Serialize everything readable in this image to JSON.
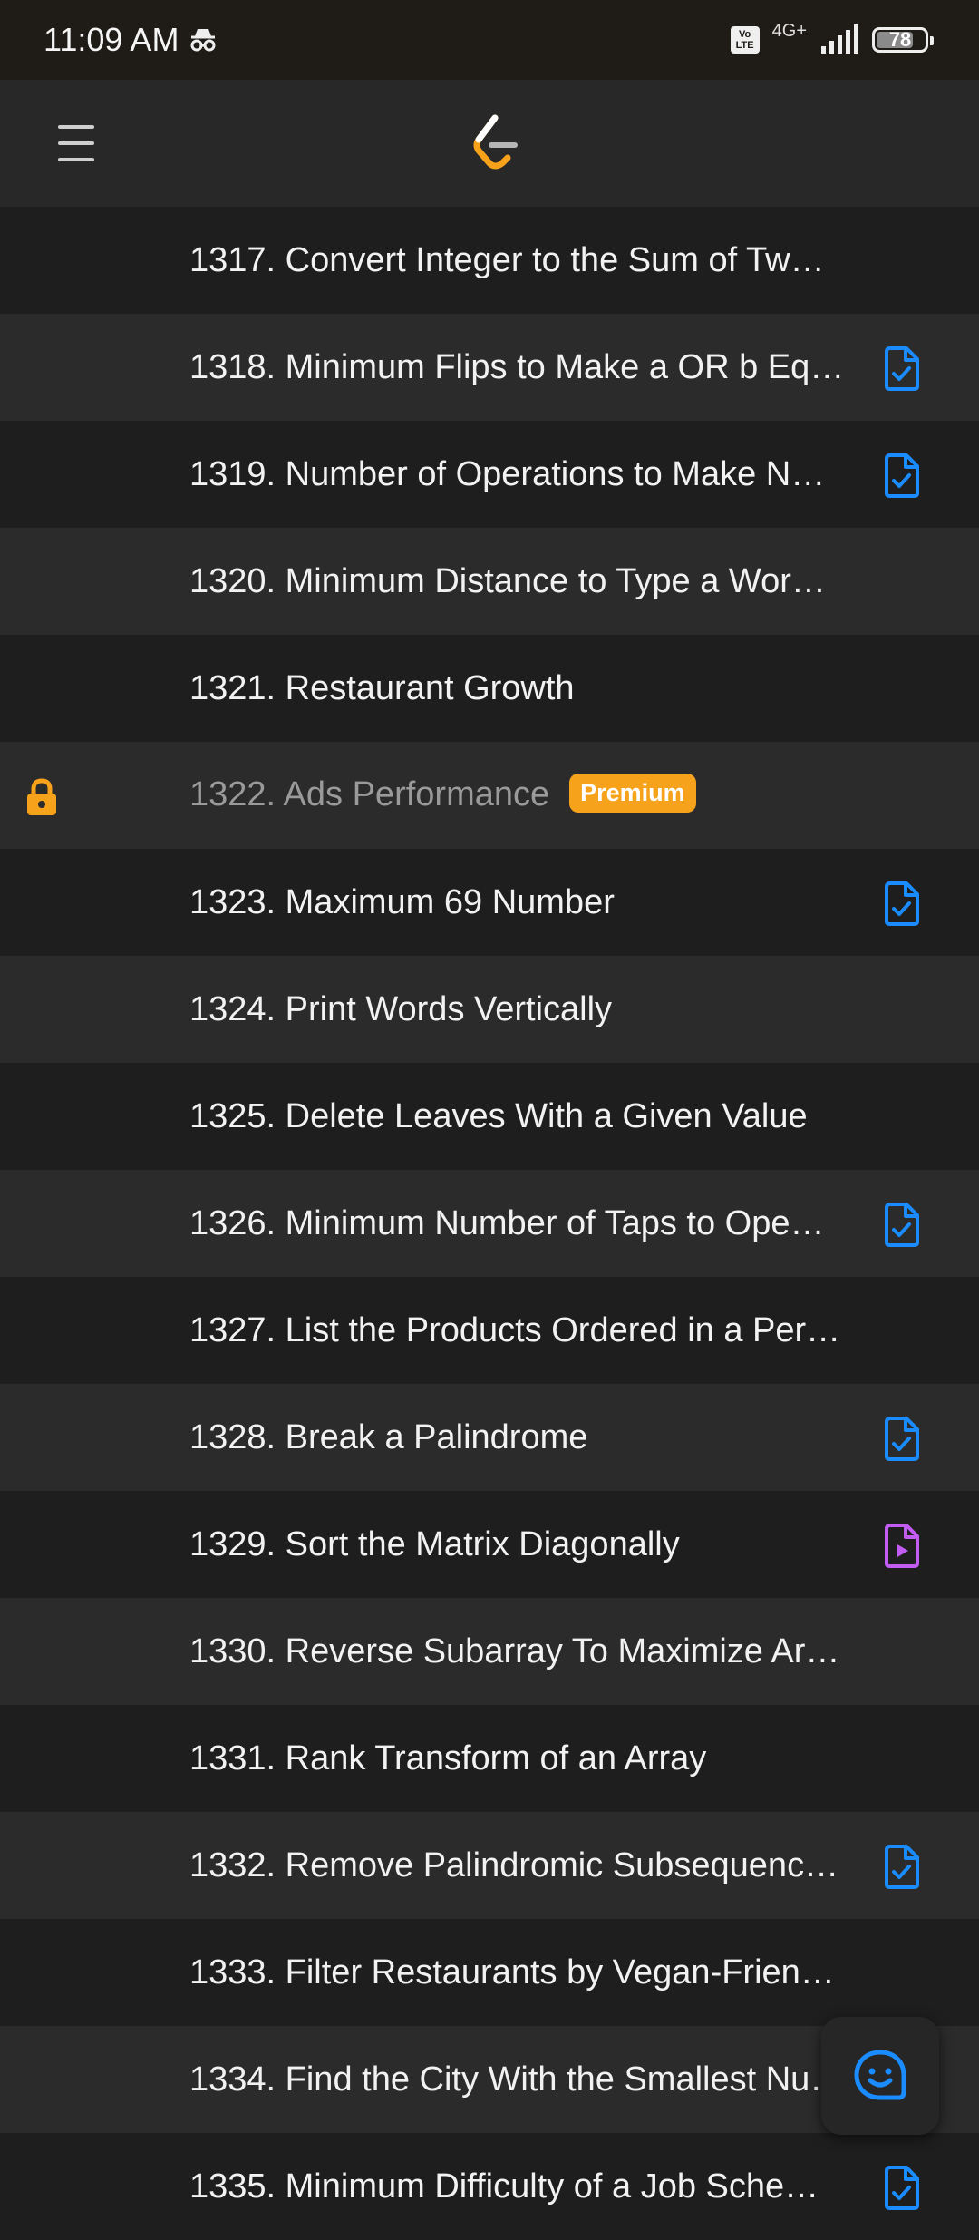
{
  "status_bar": {
    "time": "11:09 AM",
    "incognito_icon": "incognito-icon",
    "volte": "Vo LTE",
    "network": "4G+",
    "battery": 78
  },
  "app_bar": {
    "menu_icon": "hamburger-icon",
    "logo_icon": "leetcode-logo"
  },
  "colors": {
    "solved": "#1a8cff",
    "video": "#c35cf2",
    "premium": "#f7a21b",
    "lock": "#f7a21b"
  },
  "problems": [
    {
      "title": "1317. Convert Integer to the Sum of Tw…",
      "status": ""
    },
    {
      "title": "1318. Minimum Flips to Make a OR b Eq…",
      "status": "solution"
    },
    {
      "title": "1319. Number of Operations to Make N…",
      "status": "solution"
    },
    {
      "title": "1320. Minimum Distance to Type a Wor…",
      "status": ""
    },
    {
      "title": "1321. Restaurant Growth",
      "status": ""
    },
    {
      "title": "1322. Ads Performance",
      "status": "",
      "locked": true,
      "badge": "Premium"
    },
    {
      "title": "1323. Maximum 69 Number",
      "status": "solution"
    },
    {
      "title": "1324. Print Words Vertically",
      "status": ""
    },
    {
      "title": "1325. Delete Leaves With a Given Value",
      "status": ""
    },
    {
      "title": "1326. Minimum Number of Taps to Ope…",
      "status": "solution"
    },
    {
      "title": "1327. List the Products Ordered in a Per…",
      "status": ""
    },
    {
      "title": "1328. Break a Palindrome",
      "status": "solution"
    },
    {
      "title": "1329. Sort the Matrix Diagonally",
      "status": "video"
    },
    {
      "title": "1330. Reverse Subarray To Maximize Ar…",
      "status": ""
    },
    {
      "title": "1331. Rank Transform of an Array",
      "status": ""
    },
    {
      "title": "1332. Remove Palindromic Subsequenc…",
      "status": "solution"
    },
    {
      "title": "1333. Filter Restaurants by Vegan-Frien…",
      "status": ""
    },
    {
      "title": "1334. Find the City With the Smallest Nu…",
      "status": ""
    },
    {
      "title": "1335. Minimum Difficulty of a Job Sche…",
      "status": "solution"
    }
  ],
  "fab": {
    "icon": "smiley-feedback-icon"
  }
}
